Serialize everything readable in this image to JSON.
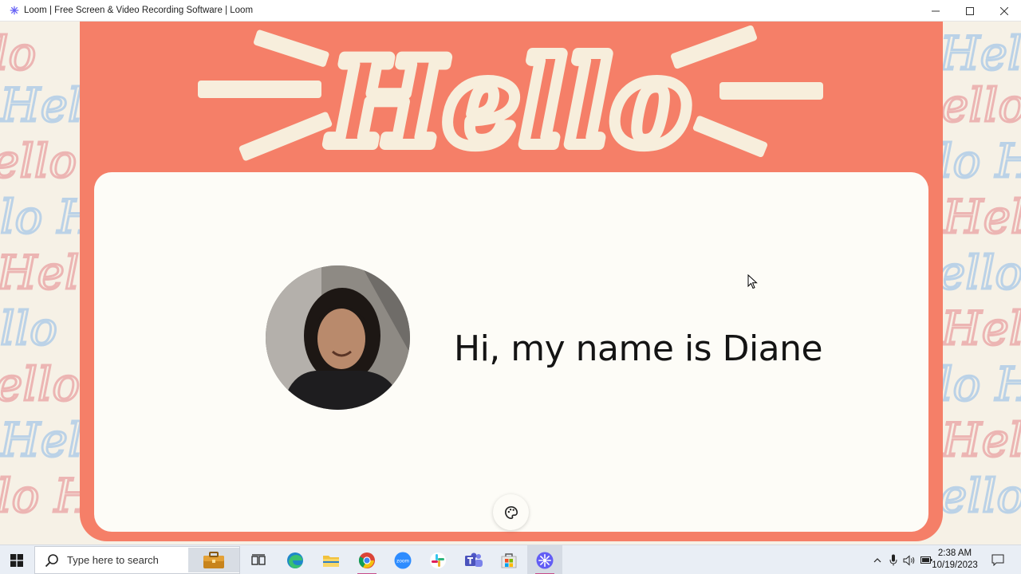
{
  "window": {
    "title": "Loom | Free Screen & Video Recording Software | Loom",
    "app_icon": "loom-icon",
    "controls": {
      "minimize": "minimize-icon",
      "maximize": "maximize-icon",
      "close": "close-icon"
    }
  },
  "stage": {
    "banner_text": "Hello",
    "greeting": "Hi, my name is Diane",
    "palette_button_icon": "palette-icon"
  },
  "taskbar": {
    "search_placeholder": "Type here to search",
    "apps": [
      "task-view-icon",
      "edge-icon",
      "file-explorer-icon",
      "chrome-icon",
      "zoom-icon",
      "slack-icon",
      "teams-icon",
      "store-icon",
      "loom-icon"
    ],
    "zoom_label": "zoom",
    "tray": [
      "chevron-up-icon",
      "microphone-icon",
      "speaker-icon",
      "battery-icon",
      "notification-icon"
    ],
    "time": "2:38 AM",
    "date": "10/19/2023"
  },
  "colors": {
    "tag_coral": "#f57f68",
    "card": "#fdfcf7",
    "hello_cream": "#f7eedc",
    "accent_loom": "#625df5"
  }
}
